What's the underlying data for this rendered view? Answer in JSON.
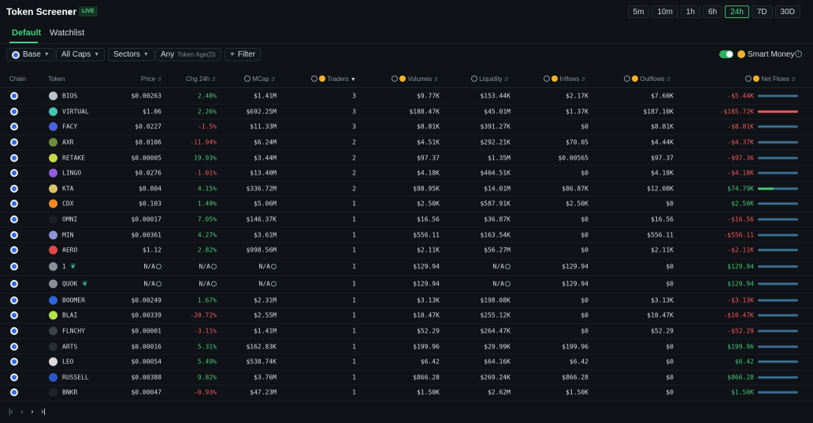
{
  "header": {
    "title": "Token Screener",
    "live_badge": "LIVE",
    "timeframes": [
      "5m",
      "10m",
      "1h",
      "6h",
      "24h",
      "7D",
      "30D"
    ],
    "active_timeframe": "24h"
  },
  "tabs": {
    "default": "Default",
    "watchlist": "Watchlist"
  },
  "filters": {
    "chain": "Base",
    "caps": "All Caps",
    "sectors": "Sectors",
    "age_prefix": "Any",
    "age_label": "Token Age(D)",
    "filter": "Filter",
    "smart_money": "Smart Money",
    "smart_money_enabled": true
  },
  "columns": {
    "chain": "Chain",
    "token": "Token",
    "price": "Price",
    "chg": "Chg 24h",
    "mcap": "MCap",
    "traders": "Traders",
    "volumes": "Volumes",
    "liquidity": "Liquidity",
    "inflows": "Inflows",
    "outflows": "Outflows",
    "netflows": "Net Flows"
  },
  "colors": {
    "positive": "#4cc777",
    "negative": "#ef5b5b",
    "accent": "#43d17b",
    "bar": "#3a6f92"
  },
  "rows": [
    {
      "token": "BIOS",
      "icon": "#b9c1c9",
      "price": "$0.00263",
      "chg": "2.48%",
      "dir": "pos",
      "mcap": "$1.41M",
      "traders": "3",
      "volumes": "$9.77K",
      "liquidity": "$153.44K",
      "inflows": "$2.17K",
      "outflows": "$7.60K",
      "net": "-$5.44K",
      "netdir": "neg",
      "net_share": 0
    },
    {
      "token": "VIRTUAL",
      "icon": "#46c7b1",
      "price": "$1.06",
      "chg": "2.26%",
      "dir": "pos",
      "mcap": "$692.25M",
      "traders": "3",
      "volumes": "$188.47K",
      "liquidity": "$45.01M",
      "inflows": "$1.37K",
      "outflows": "$187.10K",
      "net": "-$185.72K",
      "netdir": "neg",
      "net_share": 1.0
    },
    {
      "token": "FACY",
      "icon": "#4a62e0",
      "price": "$0.0227",
      "chg": "-1.5%",
      "dir": "neg",
      "mcap": "$11.33M",
      "traders": "3",
      "volumes": "$8.81K",
      "liquidity": "$391.27K",
      "inflows": "$0",
      "outflows": "$8.81K",
      "net": "-$8.81K",
      "netdir": "neg",
      "net_share": 0
    },
    {
      "token": "AXR",
      "icon": "#6f8d3e",
      "price": "$0.0106",
      "chg": "-11.94%",
      "dir": "neg",
      "mcap": "$6.24M",
      "traders": "2",
      "volumes": "$4.51K",
      "liquidity": "$292.21K",
      "inflows": "$70.05",
      "outflows": "$4.44K",
      "net": "-$4.37K",
      "netdir": "neg",
      "net_share": 0
    },
    {
      "token": "RETAKE",
      "icon": "#c9d84a",
      "price": "$0.00005",
      "chg": "19.93%",
      "dir": "pos",
      "mcap": "$3.44M",
      "traders": "2",
      "volumes": "$97.37",
      "liquidity": "$1.35M",
      "inflows": "$0.00565",
      "outflows": "$97.37",
      "net": "-$97.36",
      "netdir": "neg",
      "net_share": 0
    },
    {
      "token": "LINGO",
      "icon": "#8f5ce0",
      "price": "$0.0276",
      "chg": "-1.01%",
      "dir": "neg",
      "mcap": "$13.40M",
      "traders": "2",
      "volumes": "$4.18K",
      "liquidity": "$404.51K",
      "inflows": "$0",
      "outflows": "$4.18K",
      "net": "-$4.18K",
      "netdir": "neg",
      "net_share": 0
    },
    {
      "token": "KTA",
      "icon": "#d9c46a",
      "price": "$0.804",
      "chg": "4.15%",
      "dir": "pos",
      "mcap": "$336.72M",
      "traders": "2",
      "volumes": "$98.95K",
      "liquidity": "$14.01M",
      "inflows": "$86.87K",
      "outflows": "$12.08K",
      "net": "$74.79K",
      "netdir": "pos",
      "net_share": 0.4
    },
    {
      "token": "CDX",
      "icon": "#f08a24",
      "price": "$0.103",
      "chg": "1.49%",
      "dir": "pos",
      "mcap": "$5.06M",
      "traders": "1",
      "volumes": "$2.50K",
      "liquidity": "$587.91K",
      "inflows": "$2.50K",
      "outflows": "$0",
      "net": "$2.50K",
      "netdir": "pos",
      "net_share": 0
    },
    {
      "token": "OMNI",
      "icon": "#1c1f24",
      "price": "$0.00017",
      "chg": "7.05%",
      "dir": "pos",
      "mcap": "$146.37K",
      "traders": "1",
      "volumes": "$16.56",
      "liquidity": "$36.87K",
      "inflows": "$0",
      "outflows": "$16.56",
      "net": "-$16.56",
      "netdir": "neg",
      "net_share": 0
    },
    {
      "token": "MIN",
      "icon": "#8c94d6",
      "price": "$0.00361",
      "chg": "4.27%",
      "dir": "pos",
      "mcap": "$3.61M",
      "traders": "1",
      "volumes": "$556.11",
      "liquidity": "$163.54K",
      "inflows": "$0",
      "outflows": "$556.11",
      "net": "-$556.11",
      "netdir": "neg",
      "net_share": 0
    },
    {
      "token": "AERO",
      "icon": "#e24848",
      "price": "$1.12",
      "chg": "2.82%",
      "dir": "pos",
      "mcap": "$998.56M",
      "traders": "1",
      "volumes": "$2.11K",
      "liquidity": "$56.27M",
      "inflows": "$0",
      "outflows": "$2.11K",
      "net": "-$2.11K",
      "netdir": "neg",
      "net_share": 0
    },
    {
      "token": "1",
      "icon": "#8a9099",
      "price": "N/A",
      "chg": "N/A",
      "dir": "none",
      "mcap": "N/A",
      "traders": "1",
      "volumes": "$129.94",
      "liquidity": "N/A",
      "inflows": "$129.94",
      "outflows": "$0",
      "net": "$129.94",
      "netdir": "pos",
      "net_share": 0,
      "na": true
    },
    {
      "token": "QUOK",
      "icon": "#8a9099",
      "price": "N/A",
      "chg": "N/A",
      "dir": "none",
      "mcap": "N/A",
      "traders": "1",
      "volumes": "$129.94",
      "liquidity": "N/A",
      "inflows": "$129.94",
      "outflows": "$0",
      "net": "$129.94",
      "netdir": "pos",
      "net_share": 0,
      "na": true
    },
    {
      "token": "BOOMER",
      "icon": "#2f63d8",
      "price": "$0.00249",
      "chg": "1.67%",
      "dir": "pos",
      "mcap": "$2.31M",
      "traders": "1",
      "volumes": "$3.13K",
      "liquidity": "$198.08K",
      "inflows": "$0",
      "outflows": "$3.13K",
      "net": "-$3.13K",
      "netdir": "neg",
      "net_share": 0
    },
    {
      "token": "BLAI",
      "icon": "#b7e04a",
      "price": "$0.00339",
      "chg": "-20.72%",
      "dir": "neg",
      "mcap": "$2.55M",
      "traders": "1",
      "volumes": "$10.47K",
      "liquidity": "$255.12K",
      "inflows": "$0",
      "outflows": "$10.47K",
      "net": "-$10.47K",
      "netdir": "neg",
      "net_share": 0
    },
    {
      "token": "FLNCHY",
      "icon": "#3d424a",
      "price": "$0.00001",
      "chg": "-3.11%",
      "dir": "neg",
      "mcap": "$1.41M",
      "traders": "1",
      "volumes": "$52.29",
      "liquidity": "$264.47K",
      "inflows": "$0",
      "outflows": "$52.29",
      "net": "-$52.29",
      "netdir": "neg",
      "net_share": 0
    },
    {
      "token": "ARTS",
      "icon": "#2a2e35",
      "price": "$0.00016",
      "chg": "5.31%",
      "dir": "pos",
      "mcap": "$162.83K",
      "traders": "1",
      "volumes": "$199.96",
      "liquidity": "$29.99K",
      "inflows": "$199.96",
      "outflows": "$0",
      "net": "$199.96",
      "netdir": "pos",
      "net_share": 0
    },
    {
      "token": "LEO",
      "icon": "#d9d9d9",
      "price": "$0.00054",
      "chg": "5.49%",
      "dir": "pos",
      "mcap": "$538.74K",
      "traders": "1",
      "volumes": "$6.42",
      "liquidity": "$64.16K",
      "inflows": "$6.42",
      "outflows": "$0",
      "net": "$6.42",
      "netdir": "pos",
      "net_share": 0
    },
    {
      "token": "RUSSELL",
      "icon": "#2b56c9",
      "price": "$0.00388",
      "chg": "9.82%",
      "dir": "pos",
      "mcap": "$3.76M",
      "traders": "1",
      "volumes": "$866.28",
      "liquidity": "$269.24K",
      "inflows": "$866.28",
      "outflows": "$0",
      "net": "$866.28",
      "netdir": "pos",
      "net_share": 0
    },
    {
      "token": "BNKR",
      "icon": "#1f2228",
      "price": "$0.00047",
      "chg": "-0.93%",
      "dir": "neg",
      "mcap": "$47.23M",
      "traders": "1",
      "volumes": "$1.50K",
      "liquidity": "$2.62M",
      "inflows": "$1.50K",
      "outflows": "$0",
      "net": "$1.50K",
      "netdir": "pos",
      "net_share": 0
    }
  ],
  "pager": [
    "|‹",
    "‹",
    "›",
    "›|"
  ]
}
